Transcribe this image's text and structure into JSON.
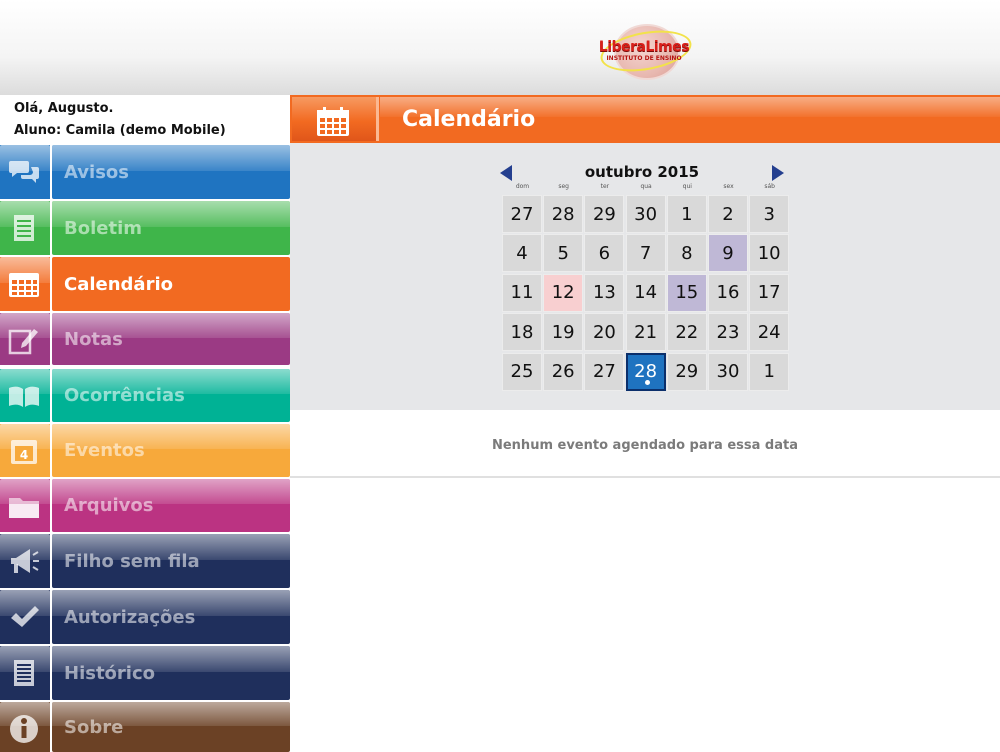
{
  "header": {
    "logo_text": "LiberaLimes",
    "logo_sub": "INSTITUTO DE ENSINO"
  },
  "user": {
    "greeting": "Olá, Augusto.",
    "student": "Aluno: Camila (demo Mobile)"
  },
  "menu": [
    {
      "label": "Avisos",
      "color": "#1f74c1",
      "icon": "chat-bubbles-icon"
    },
    {
      "label": "Boletim",
      "color": "#3fb54a",
      "icon": "document-icon"
    },
    {
      "label": "Calendário",
      "color": "#f26a21",
      "icon": "calendar-icon",
      "active": true
    },
    {
      "label": "Notas",
      "color": "#9b3a84",
      "icon": "edit-note-icon"
    },
    {
      "label": "Ocorrências",
      "color": "#00b295",
      "icon": "book-icon"
    },
    {
      "label": "Eventos",
      "color": "#f7a93b",
      "icon": "event-calendar-icon"
    },
    {
      "label": "Arquivos",
      "color": "#bb3382",
      "icon": "folder-icon"
    },
    {
      "label": "Filho sem fila",
      "color": "#1f2f5c",
      "icon": "megaphone-icon"
    },
    {
      "label": "Autorizações",
      "color": "#1f2f5c",
      "icon": "checkmark-icon"
    },
    {
      "label": "Histórico",
      "color": "#1f2f5c",
      "icon": "list-document-icon"
    },
    {
      "label": "Sobre",
      "color": "#6b4125",
      "icon": "info-icon"
    }
  ],
  "page": {
    "title": "Calendário"
  },
  "calendar": {
    "month_label": "outubro 2015",
    "weekdays": [
      "dom",
      "seg",
      "ter",
      "qua",
      "qui",
      "sex",
      "sáb"
    ],
    "weeks": [
      [
        "27",
        "28",
        "29",
        "30",
        "1",
        "2",
        "3"
      ],
      [
        "4",
        "5",
        "6",
        "7",
        "8",
        "9",
        "10"
      ],
      [
        "11",
        "12",
        "13",
        "14",
        "15",
        "16",
        "17"
      ],
      [
        "18",
        "19",
        "20",
        "21",
        "22",
        "23",
        "24"
      ],
      [
        "25",
        "26",
        "27",
        "28",
        "29",
        "30",
        "1"
      ]
    ],
    "highlights": {
      "pink": [
        "2-1"
      ],
      "purple": [
        "1-5",
        "2-4"
      ],
      "today": [
        "4-3"
      ]
    },
    "colors": {
      "pink": "#f8cfd0",
      "purple": "#bfb8d6",
      "today": "#1f73c0"
    }
  },
  "events": {
    "empty_message": "Nenhum evento agendado para essa data"
  }
}
